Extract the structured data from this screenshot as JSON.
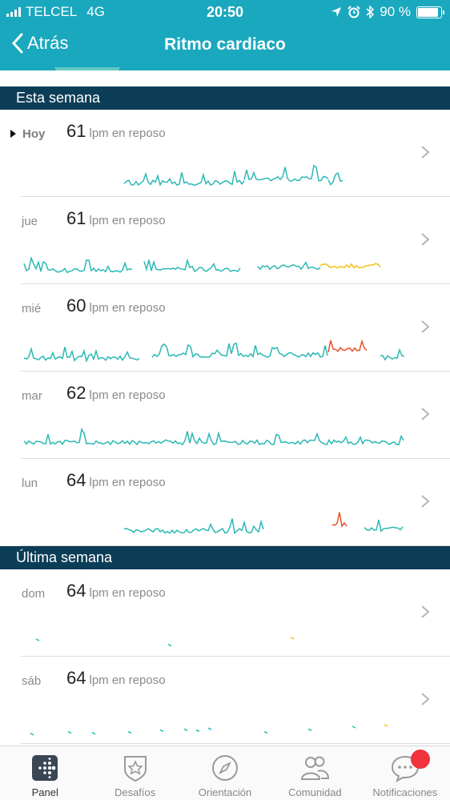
{
  "status": {
    "carrier": "TELCEL",
    "network": "4G",
    "time": "20:50",
    "battery": "90 %",
    "battery_level": 0.9
  },
  "nav": {
    "back_label": "Atrás",
    "title": "Ritmo cardiaco"
  },
  "sections": [
    {
      "title": "Esta semana",
      "rows": [
        {
          "day": "Hoy",
          "bpm": "61",
          "unit": "lpm en reposo",
          "today": true
        },
        {
          "day": "jue",
          "bpm": "61",
          "unit": "lpm en reposo"
        },
        {
          "day": "mié",
          "bpm": "60",
          "unit": "lpm en reposo"
        },
        {
          "day": "mar",
          "bpm": "62",
          "unit": "lpm en reposo"
        },
        {
          "day": "lun",
          "bpm": "64",
          "unit": "lpm en reposo"
        }
      ]
    },
    {
      "title": "Última semana",
      "rows": [
        {
          "day": "dom",
          "bpm": "64",
          "unit": "lpm en reposo"
        },
        {
          "day": "sáb",
          "bpm": "64",
          "unit": "lpm en reposo"
        }
      ]
    }
  ],
  "tabs": [
    {
      "label": "Panel",
      "icon": "dashboard-icon",
      "active": true
    },
    {
      "label": "Desafíos",
      "icon": "challenges-star-icon"
    },
    {
      "label": "Orientación",
      "icon": "compass-icon"
    },
    {
      "label": "Comunidad",
      "icon": "community-icon"
    },
    {
      "label": "Notificaciones",
      "icon": "notifications-icon",
      "badge": true
    }
  ],
  "colors": {
    "header": "#1aa8bf",
    "section": "#0c3d57",
    "low": "#2bb9b4",
    "mid": "#f2c314",
    "high": "#e8522a"
  }
}
